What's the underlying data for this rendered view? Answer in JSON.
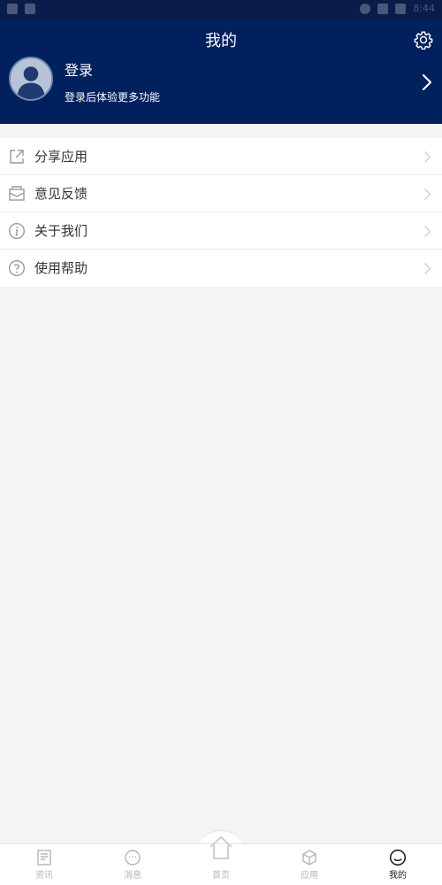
{
  "status_bar": {
    "time": "8:44"
  },
  "header": {
    "title": "我的",
    "login_title": "登录",
    "login_subtitle": "登录后体验更多功能",
    "settings_icon": "gear-icon",
    "avatar_icon": "user-avatar-icon",
    "chevron_icon": "chevron-right-icon"
  },
  "menu": {
    "items": [
      {
        "label": "分享应用",
        "icon": "share-icon"
      },
      {
        "label": "意见反馈",
        "icon": "feedback-icon"
      },
      {
        "label": "关于我们",
        "icon": "info-icon"
      },
      {
        "label": "使用帮助",
        "icon": "help-icon"
      }
    ]
  },
  "tabbar": {
    "tabs": [
      {
        "label": "资讯",
        "icon": "news-icon",
        "active": false
      },
      {
        "label": "消息",
        "icon": "message-icon",
        "active": false
      },
      {
        "label": "首页",
        "icon": "home-icon",
        "active": false
      },
      {
        "label": "应用",
        "icon": "apps-icon",
        "active": false
      },
      {
        "label": "我的",
        "icon": "profile-icon",
        "active": true
      }
    ]
  },
  "colors": {
    "header_bg": "#01205e",
    "page_bg": "#f4f4f4",
    "active_tab": "#222222",
    "inactive_tab": "#b5b5b5"
  }
}
